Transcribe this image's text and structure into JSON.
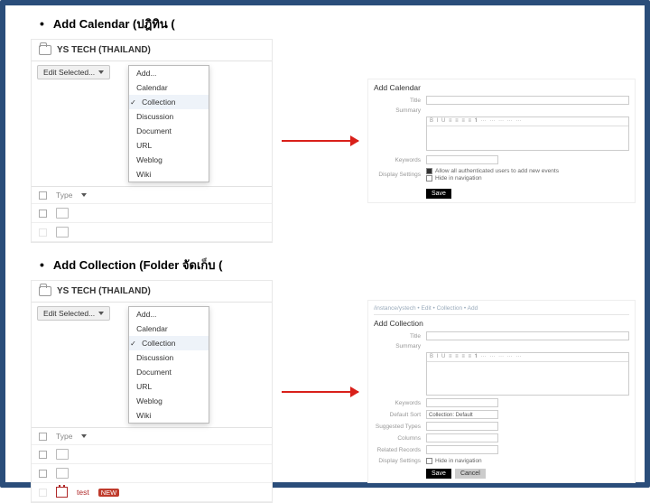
{
  "section1": {
    "bullet": "•",
    "title": "Add Calendar (ปฎิทิน   (",
    "folder_title": "YS TECH (THAILAND)",
    "edit_selected": "Edit Selected...",
    "dropdown": {
      "items": [
        "Add...",
        "Calendar",
        "Collection",
        "Discussion",
        "Document",
        "URL",
        "Weblog",
        "Wiki"
      ],
      "selected": "Collection"
    },
    "type_header": "Type",
    "right": {
      "title": "Add Calendar",
      "labels": {
        "title": "Title",
        "summary": "Summary"
      },
      "keywords_label": "Keywords",
      "keywords_value": "",
      "display_label": "Display Settings",
      "cb1": "Allow all authenticated users to add new events",
      "cb2": "Hide in navigation",
      "save": "Save"
    }
  },
  "section2": {
    "bullet": "•",
    "title": "Add Collection (Folder จัดเก็บ   (",
    "folder_title": "YS TECH (THAILAND)",
    "edit_selected": "Edit Selected...",
    "dropdown": {
      "items": [
        "Add...",
        "Calendar",
        "Collection",
        "Discussion",
        "Document",
        "URL",
        "Weblog",
        "Wiki"
      ],
      "selected": "Collection"
    },
    "type_header": "Type",
    "row_test": "test",
    "badge_new": "NEW",
    "right": {
      "breadcrumb": "/instance/ystech  •  Edit  •  Collection  •  Add",
      "title": "Add Collection",
      "labels": {
        "title": "Title",
        "summary": "Summary",
        "keywords": "Keywords",
        "default_sort": "Default Sort",
        "suggested": "Suggested Types",
        "columns": "Columns",
        "related": "Related Records",
        "display": "Display Settings"
      },
      "select_value": "Collection: Default",
      "cb_hide": "Hide in navigation",
      "save": "Save",
      "cancel": "Cancel"
    }
  }
}
